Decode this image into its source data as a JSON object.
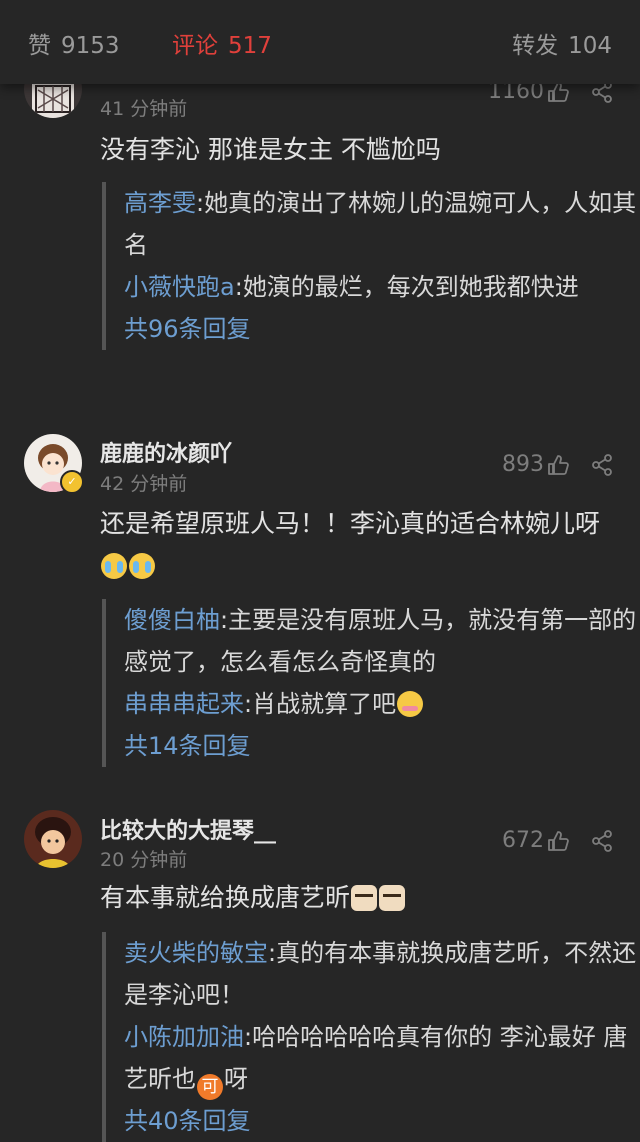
{
  "tabs": [
    {
      "label": "赞",
      "count": "9153",
      "active": false
    },
    {
      "label": "评论",
      "count": "517",
      "active": true
    },
    {
      "label": "转发",
      "count": "104",
      "active": false
    }
  ],
  "comments": [
    {
      "username": "",
      "time": "41 分钟前",
      "likes": "1160",
      "text": "没有李沁 那谁是女主 不尴尬吗",
      "replies": [
        {
          "name": "高李雯",
          "text": "她真的演出了林婉儿的温婉可人，人如其名"
        },
        {
          "name": "小薇快跑a",
          "text": "她演的最烂，每次到她我都快进"
        }
      ],
      "more": "共96条回复"
    },
    {
      "username": "鹿鹿的冰颜吖",
      "time": "42 分钟前",
      "likes": "893",
      "text": "还是希望原班人马！！李沁真的适合林婉儿呀",
      "emojis": [
        "cry",
        "cry"
      ],
      "replies": [
        {
          "name": "傻傻白柚",
          "text": "主要是没有原班人马，就没有第一部的感觉了，怎么看怎么奇怪真的"
        },
        {
          "name": "串串串起来",
          "text": "肖战就算了吧",
          "emoji": "blush"
        }
      ],
      "more": "共14条回复"
    },
    {
      "username": "比较大的大提琴__",
      "time": "20 分钟前",
      "likes": "672",
      "text": "有本事就给换成唐艺昕",
      "emojis": [
        "cat",
        "cat"
      ],
      "replies": [
        {
          "name": "卖火柴的敏宝",
          "text": "真的有本事就换成唐艺昕，不然还是李沁吧！"
        },
        {
          "name": "小陈加加油",
          "text_before": "哈哈哈哈哈哈真有你的 李沁最好 唐艺昕也",
          "emoji_text": "可",
          "text_after": "呀"
        }
      ],
      "more": "共40条回复"
    }
  ],
  "colors": {
    "background": "#262626",
    "active_tab": "#e0403b",
    "reply_name": "#6d9ed1",
    "muted": "#7d7d7d"
  },
  "icons": [
    "thumbs-up-icon",
    "share-icon",
    "verified-badge-icon"
  ]
}
